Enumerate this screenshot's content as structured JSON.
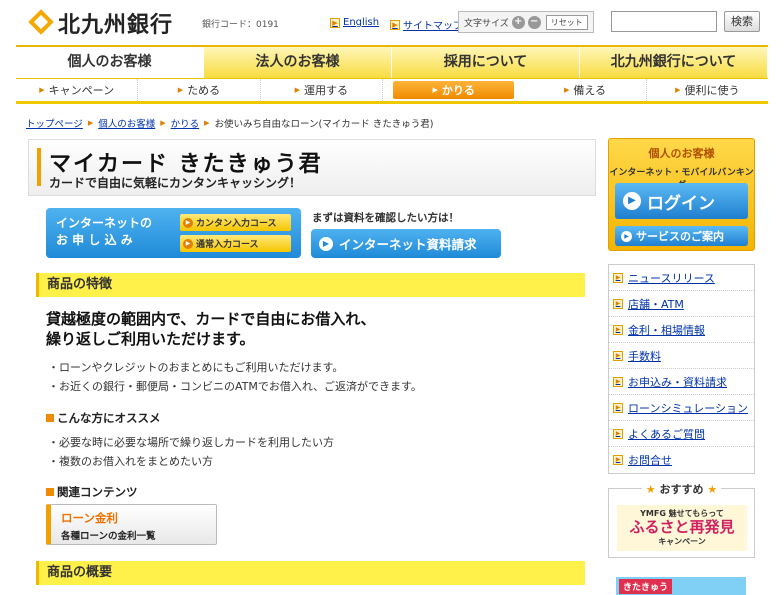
{
  "header": {
    "logo_text": "北九州銀行",
    "bank_code": "銀行コード：0191",
    "links": [
      "English",
      "サイトマップ"
    ],
    "font_size_label": "文字サイズ",
    "font_plus": "+",
    "font_minus": "−",
    "reset_label": "リセット",
    "search_placeholder": "",
    "search_button": "検索"
  },
  "tabs": [
    {
      "label": "個人のお客様",
      "active": true
    },
    {
      "label": "法人のお客様",
      "active": false
    },
    {
      "label": "採用について",
      "active": false
    },
    {
      "label": "北九州銀行について",
      "active": false
    }
  ],
  "subnav": [
    {
      "label": "キャンペーン",
      "active": false
    },
    {
      "label": "ためる",
      "active": false
    },
    {
      "label": "運用する",
      "active": false
    },
    {
      "label": "かりる",
      "active": true
    },
    {
      "label": "備える",
      "active": false
    },
    {
      "label": "便利に使う",
      "active": false
    }
  ],
  "breadcrumb": {
    "items": [
      "トップページ",
      "個人のお客様",
      "かりる"
    ],
    "current": "お使いみち自由なローン(マイカード きたきゅう君)"
  },
  "product": {
    "title": "マイカード きたきゅう君",
    "subtitle": "カードで自由に気軽にカンタンキャッシング！"
  },
  "apply": {
    "label_line1": "インターネットの",
    "label_line2": "お 申 し 込 み",
    "easy_label": "カンタン入力コース",
    "normal_label": "通常入力コース",
    "doc_note": "まずは資料を確認したい方は！",
    "doc_button": "インターネット資料請求"
  },
  "features": {
    "heading": "商品の特徴",
    "lead_line1": "貸越極度の範囲内で、カードで自由にお借入れ、",
    "lead_line2": "繰り返しご利用いただけます。",
    "bullets": [
      "ローンやクレジットのおまとめにもご利用いただけます。",
      "お近くの銀行・郵便局・コンビニのATMでお借入れ、ご返済ができます。"
    ]
  },
  "recommend": {
    "heading": "こんな方にオススメ",
    "bullets": [
      "必要な時に必要な場所で繰り返しカードを利用したい方",
      "複数のお借入れをまとめたい方"
    ]
  },
  "related": {
    "heading": "関連コンテンツ",
    "card_title": "ローン金利",
    "card_sub": "各種ローンの金利一覧"
  },
  "overview": {
    "heading": "商品の概要"
  },
  "sidebar": {
    "login_category": "個人のお客様",
    "login_service": "インターネット・モバイルバンキング",
    "login_button": "ログイン",
    "service_button": "サービスのご案内",
    "menu": [
      "ニュースリリース",
      "店舗・ATM",
      "金利・相場情報",
      "手数料",
      "お申込み・資料請求",
      "ローンシミュレーション",
      "よくあるご質問",
      "お問合せ"
    ],
    "recommend_title": "おすすめ",
    "banner_line1": "YMFG 魅せてもらって",
    "banner_line2": "ふるさと再発見",
    "banner_line3": "キャンペーン",
    "banner2_label": "きたきゅう"
  },
  "colors": {
    "accent_yellow": "#f4b400",
    "accent_orange": "#f08a00",
    "link_blue": "#0033aa",
    "button_blue": "#1f8ad8"
  }
}
